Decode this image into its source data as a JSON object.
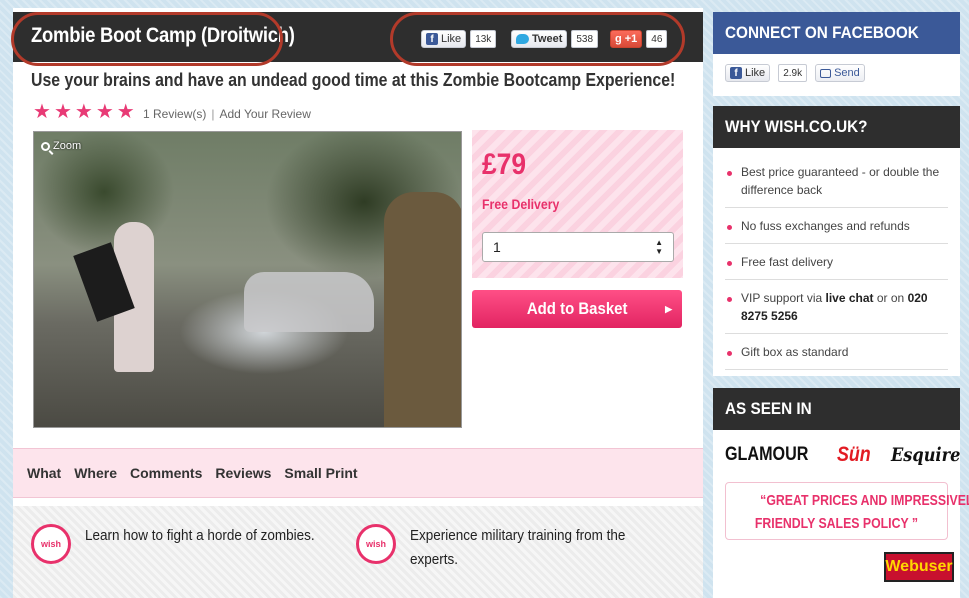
{
  "product": {
    "title": "Zombie Boot Camp (Droitwich)",
    "subtitle": "Use your brains and have an undead good time at this Zombie Bootcamp Experience!",
    "rating": 5,
    "reviews_label": "1 Review(s)",
    "add_review_label": "Add Your Review",
    "zoom_label": "Zoom",
    "price": "£79",
    "delivery": "Free Delivery",
    "quantity": "1",
    "add_to_basket": "Add to Basket"
  },
  "social": {
    "like_label": "Like",
    "like_count": "13k",
    "tweet_label": "Tweet",
    "tweet_count": "538",
    "plusone_label": "+1",
    "plusone_count": "46"
  },
  "tabs": [
    "What",
    "Where",
    "Comments",
    "Reviews",
    "Small Print"
  ],
  "features": [
    {
      "text_line1": "Learn how to fight a horde of zombies.",
      "text_line2": ""
    },
    {
      "text_line1": "Experience military training from the",
      "text_line2": "experts."
    }
  ],
  "badge_text": "wish",
  "sidebar": {
    "facebook": {
      "heading": "CONNECT ON FACEBOOK",
      "like_label": "Like",
      "like_count": "2.9k",
      "send_label": "Send"
    },
    "why": {
      "heading": "WHY WISH.CO.UK?",
      "items": [
        "Best price guaranteed - or double the difference back",
        "No fuss exchanges and refunds",
        "Free fast delivery",
        "Gift box as standard"
      ],
      "vip_prefix": "VIP support via ",
      "vip_chat": "live chat",
      "vip_middle": " or on ",
      "vip_phone": "020 8275 5256"
    },
    "seen": {
      "heading": "AS SEEN IN",
      "logos": [
        "GLAMOUR",
        "Sün",
        "Esquire"
      ],
      "quote_line1": "“GREAT PRICES AND IMPRESSIVELY",
      "quote_line2": "FRIENDLY SALES POLICY ”",
      "webuser_label": "Webuser"
    }
  },
  "colors": {
    "accent": "#e8316b",
    "header_dark": "#2e2e2e",
    "facebook_blue": "#3b5998",
    "highlight_oval": "#b23a2a"
  }
}
